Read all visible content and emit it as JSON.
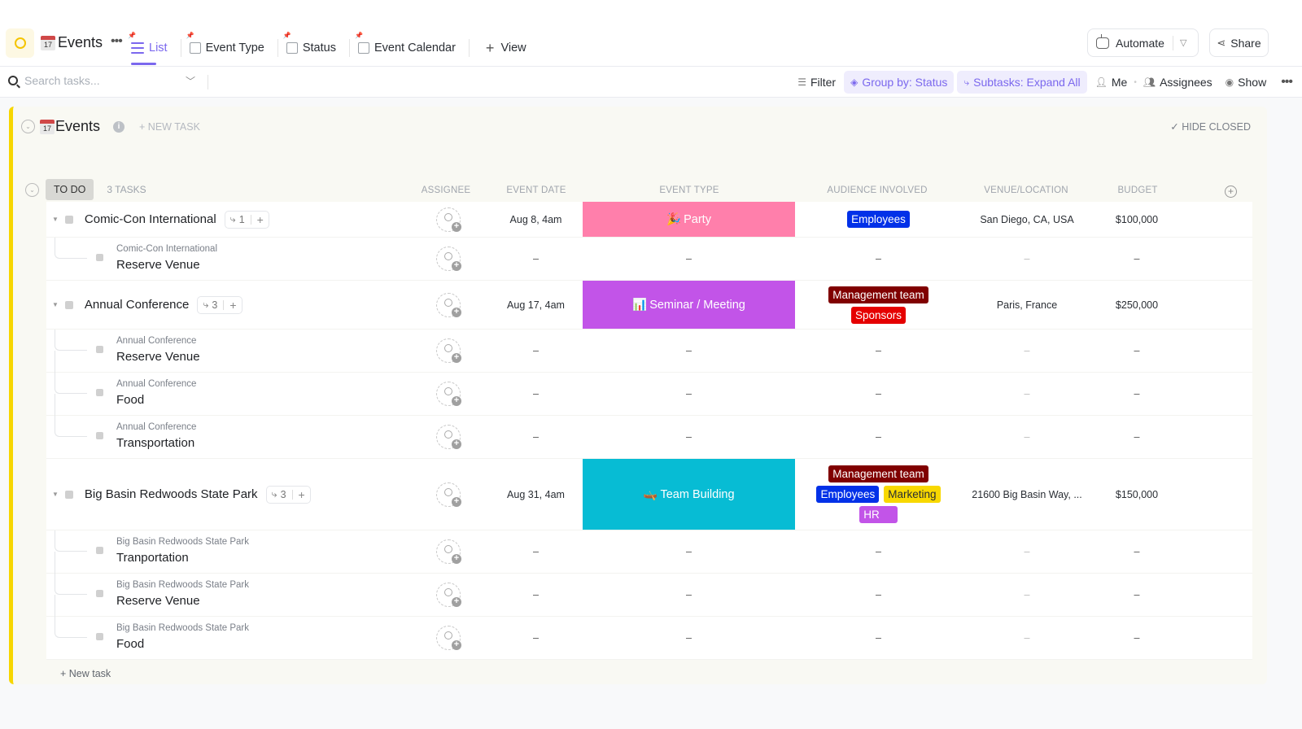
{
  "header": {
    "space_icon": "circle-icon",
    "title_emoji": "17",
    "title": "Events",
    "views": [
      {
        "label": "List",
        "icon": "list-icon",
        "active": true
      },
      {
        "label": "Event Type",
        "icon": "board-icon",
        "active": false
      },
      {
        "label": "Status",
        "icon": "board-icon",
        "active": false
      },
      {
        "label": "Event Calendar",
        "icon": "calendar-icon",
        "active": false
      }
    ],
    "add_view_label": "View",
    "automate_label": "Automate",
    "share_label": "Share"
  },
  "toolbar": {
    "search_placeholder": "Search tasks...",
    "filter_label": "Filter",
    "group_by_label": "Group by: Status",
    "subtasks_label": "Subtasks: Expand All",
    "me_label": "Me",
    "assignees_label": "Assignees",
    "show_label": "Show"
  },
  "group": {
    "emoji": "17",
    "title": "Events",
    "new_task_label": "+ NEW TASK",
    "hide_closed_label": "HIDE CLOSED",
    "status_label": "TO DO",
    "task_count": "3 TASKS",
    "new_task_bottom": "+ New task"
  },
  "columns": [
    "ASSIGNEE",
    "EVENT DATE",
    "EVENT TYPE",
    "AUDIENCE INVOLVED",
    "VENUE/LOCATION",
    "BUDGET"
  ],
  "colors": {
    "accent": "#7b68ee",
    "party": "#ff7fab",
    "seminar": "#c254e8",
    "team_building": "#07bcd4",
    "employees": "#0231e8",
    "management": "#800000",
    "sponsors": "#e50000",
    "marketing": "#f8d800",
    "hr": "#c254e8",
    "status_bar": "#f7d600"
  },
  "tasks": [
    {
      "name": "Comic-Con International",
      "subtask_count": "1",
      "date": "Aug 8, 4am",
      "event_type": "Party",
      "event_type_emoji": "🎉",
      "audience": [
        "Employees"
      ],
      "venue": "San Diego, CA, USA",
      "budget": "$100,000",
      "subtasks": [
        {
          "parent": "Comic-Con International",
          "name": "Reserve Venue",
          "date": "–",
          "event_type": "–",
          "audience": "–",
          "venue": "–",
          "budget": "–"
        }
      ]
    },
    {
      "name": "Annual Conference",
      "subtask_count": "3",
      "date": "Aug 17, 4am",
      "event_type": "Seminar / Meeting",
      "event_type_emoji": "📊",
      "audience": [
        "Management team",
        "Sponsors"
      ],
      "venue": "Paris, France",
      "budget": "$250,000",
      "subtasks": [
        {
          "parent": "Annual Conference",
          "name": "Reserve Venue",
          "date": "–",
          "event_type": "–",
          "audience": "–",
          "venue": "–",
          "budget": "–"
        },
        {
          "parent": "Annual Conference",
          "name": "Food",
          "date": "–",
          "event_type": "–",
          "audience": "–",
          "venue": "–",
          "budget": "–"
        },
        {
          "parent": "Annual Conference",
          "name": "Transportation",
          "date": "–",
          "event_type": "–",
          "audience": "–",
          "venue": "–",
          "budget": "–"
        }
      ]
    },
    {
      "name": "Big Basin Redwoods State Park",
      "subtask_count": "3",
      "date": "Aug 31, 4am",
      "event_type": "Team Building",
      "event_type_emoji": "🛶",
      "audience": [
        "Management team",
        "Employees",
        "Marketing",
        "HR"
      ],
      "venue": "21600 Big Basin Way, ...",
      "budget": "$150,000",
      "subtasks": [
        {
          "parent": "Big Basin Redwoods State Park",
          "name": "Tranportation",
          "date": "–",
          "event_type": "–",
          "audience": "–",
          "venue": "–",
          "budget": "–"
        },
        {
          "parent": "Big Basin Redwoods State Park",
          "name": "Reserve Venue",
          "date": "–",
          "event_type": "–",
          "audience": "–",
          "venue": "–",
          "budget": "–"
        },
        {
          "parent": "Big Basin Redwoods State Park",
          "name": "Food",
          "date": "–",
          "event_type": "–",
          "audience": "–",
          "venue": "–",
          "budget": "–"
        }
      ]
    }
  ]
}
